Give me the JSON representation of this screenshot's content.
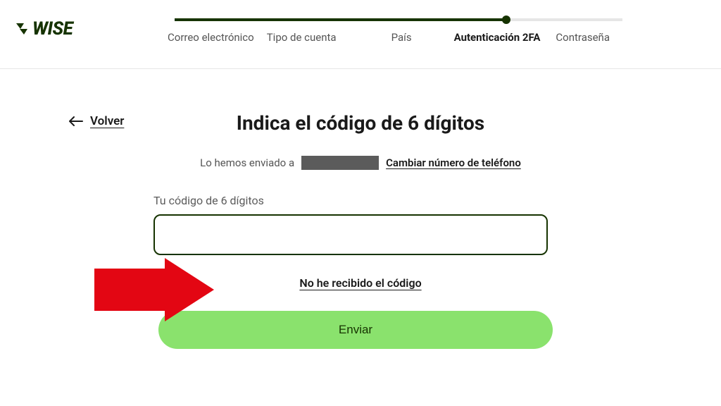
{
  "brand": {
    "name": "WISE"
  },
  "stepper": {
    "steps": [
      {
        "label": "Correo electrónico"
      },
      {
        "label": "Tipo de cuenta"
      },
      {
        "label": "País"
      },
      {
        "label": "Autenticación 2FA",
        "active": true
      },
      {
        "label": "Contraseña"
      }
    ]
  },
  "back": {
    "label": "Volver"
  },
  "main": {
    "title": "Indica el código de 6 dígitos",
    "sent_prefix": "Lo hemos enviado a",
    "change_phone": "Cambiar número de teléfono",
    "field_label": "Tu código de 6 dígitos",
    "code_value": "",
    "not_received": "No he recibido el código",
    "submit": "Enviar"
  }
}
